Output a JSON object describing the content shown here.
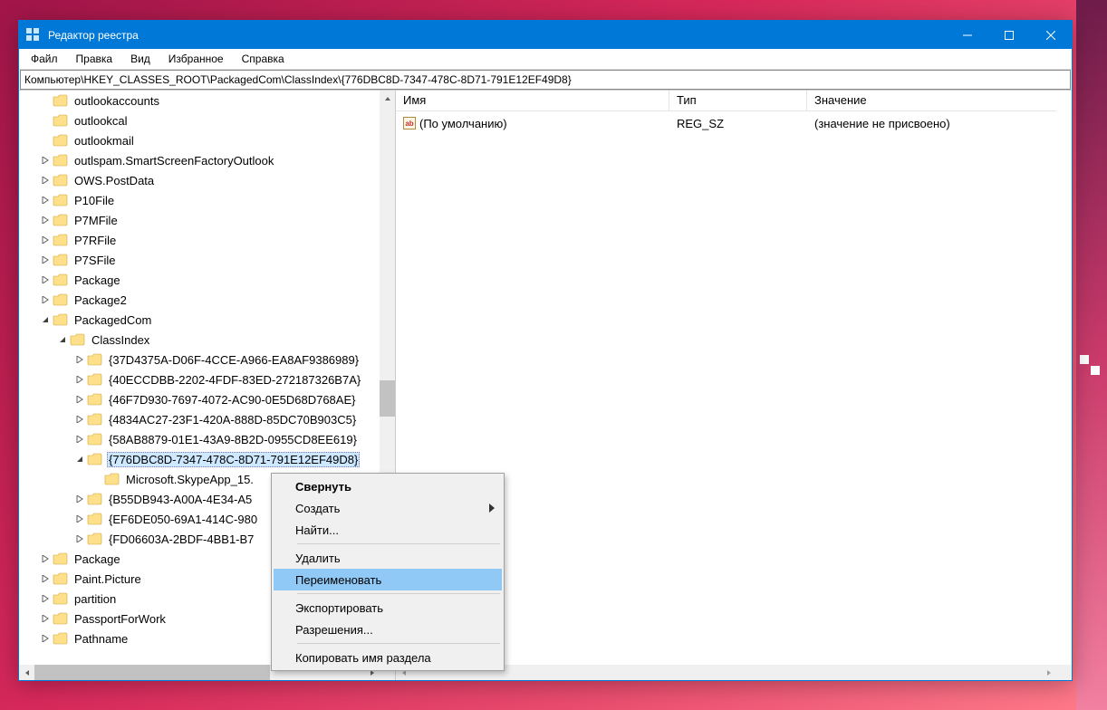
{
  "titlebar": {
    "title": "Редактор реестра"
  },
  "menu": {
    "file": "Файл",
    "edit": "Правка",
    "view": "Вид",
    "favorites": "Избранное",
    "help": "Справка"
  },
  "address": "Компьютер\\HKEY_CLASSES_ROOT\\PackagedCom\\ClassIndex\\{776DBC8D-7347-478C-8D71-791E12EF49D8}",
  "tree": [
    {
      "indent": 1,
      "exp": "none",
      "label": "outlookaccounts"
    },
    {
      "indent": 1,
      "exp": "none",
      "label": "outlookcal"
    },
    {
      "indent": 1,
      "exp": "none",
      "label": "outlookmail"
    },
    {
      "indent": 1,
      "exp": "closed",
      "label": "outlspam.SmartScreenFactoryOutlook"
    },
    {
      "indent": 1,
      "exp": "closed",
      "label": "OWS.PostData"
    },
    {
      "indent": 1,
      "exp": "closed",
      "label": "P10File"
    },
    {
      "indent": 1,
      "exp": "closed",
      "label": "P7MFile"
    },
    {
      "indent": 1,
      "exp": "closed",
      "label": "P7RFile"
    },
    {
      "indent": 1,
      "exp": "closed",
      "label": "P7SFile"
    },
    {
      "indent": 1,
      "exp": "closed",
      "label": "Package"
    },
    {
      "indent": 1,
      "exp": "closed",
      "label": "Package2"
    },
    {
      "indent": 1,
      "exp": "open",
      "label": "PackagedCom"
    },
    {
      "indent": 2,
      "exp": "open",
      "label": "ClassIndex"
    },
    {
      "indent": 3,
      "exp": "closed",
      "label": "{37D4375A-D06F-4CCE-A966-EA8AF9386989}"
    },
    {
      "indent": 3,
      "exp": "closed",
      "label": "{40ECCDBB-2202-4FDF-83ED-272187326B7A}"
    },
    {
      "indent": 3,
      "exp": "closed",
      "label": "{46F7D930-7697-4072-AC90-0E5D68D768AE}"
    },
    {
      "indent": 3,
      "exp": "closed",
      "label": "{4834AC27-23F1-420A-888D-85DC70B903C5}"
    },
    {
      "indent": 3,
      "exp": "closed",
      "label": "{58AB8879-01E1-43A9-8B2D-0955CD8EE619}"
    },
    {
      "indent": 3,
      "exp": "open",
      "label": "{776DBC8D-7347-478C-8D71-791E12EF49D8}",
      "selected": true
    },
    {
      "indent": 4,
      "exp": "none",
      "label": "Microsoft.SkypeApp_15."
    },
    {
      "indent": 3,
      "exp": "closed",
      "label": "{B55DB943-A00A-4E34-A5"
    },
    {
      "indent": 3,
      "exp": "closed",
      "label": "{EF6DE050-69A1-414C-980"
    },
    {
      "indent": 3,
      "exp": "closed",
      "label": "{FD06603A-2BDF-4BB1-B7"
    },
    {
      "indent": 1,
      "exp": "closed",
      "label": "Package"
    },
    {
      "indent": 1,
      "exp": "closed",
      "label": "Paint.Picture"
    },
    {
      "indent": 1,
      "exp": "closed",
      "label": "partition"
    },
    {
      "indent": 1,
      "exp": "closed",
      "label": "PassportForWork"
    },
    {
      "indent": 1,
      "exp": "closed",
      "label": "Pathname"
    }
  ],
  "list": {
    "cols": {
      "name": "Имя",
      "type": "Тип",
      "value": "Значение"
    },
    "row": {
      "name": "(По умолчанию)",
      "type": "REG_SZ",
      "value": "(значение не присвоено)"
    }
  },
  "ctx": {
    "collapse": "Свернуть",
    "new": "Создать",
    "find": "Найти...",
    "delete": "Удалить",
    "rename": "Переименовать",
    "export": "Экспортировать",
    "permissions": "Разрешения...",
    "copykey": "Копировать имя раздела"
  }
}
